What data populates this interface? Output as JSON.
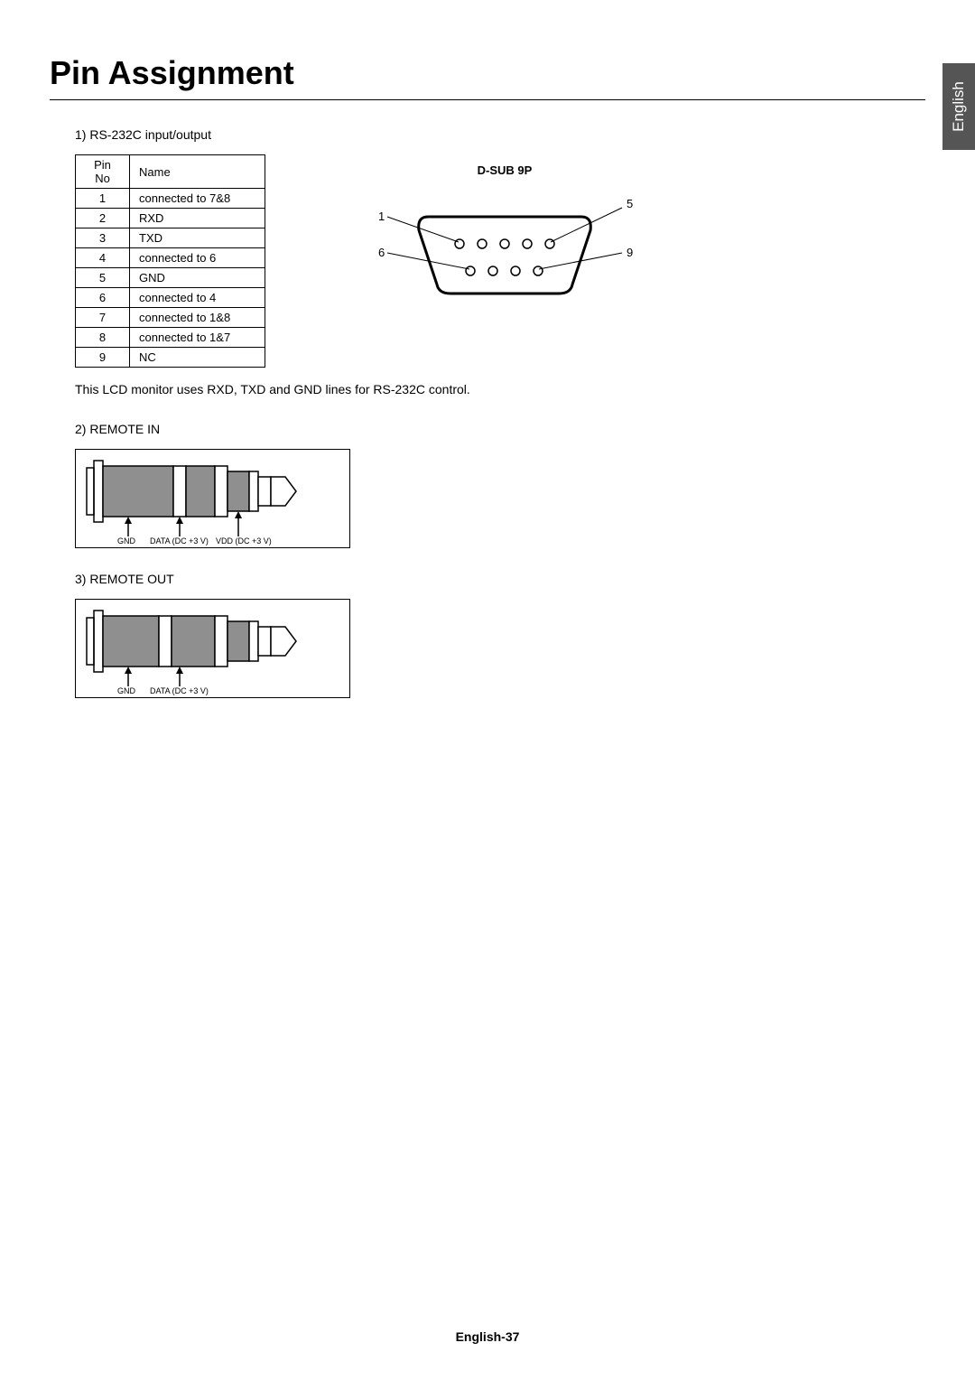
{
  "title": "Pin Assignment",
  "sideTab": "English",
  "section1": {
    "label": "1)  RS-232C input/output",
    "tableHeader": {
      "col1": "Pin No",
      "col2": "Name"
    },
    "rows": [
      {
        "no": "1",
        "name": "connected to 7&8"
      },
      {
        "no": "2",
        "name": "RXD"
      },
      {
        "no": "3",
        "name": "TXD"
      },
      {
        "no": "4",
        "name": "connected to 6"
      },
      {
        "no": "5",
        "name": "GND"
      },
      {
        "no": "6",
        "name": "connected to 4"
      },
      {
        "no": "7",
        "name": "connected to 1&8"
      },
      {
        "no": "8",
        "name": "connected to 1&7"
      },
      {
        "no": "9",
        "name": "NC"
      }
    ],
    "dsubTitle": "D-SUB 9P",
    "dsubNumbers": {
      "tl": "1",
      "tr": "5",
      "bl": "6",
      "br": "9"
    },
    "note": "This LCD monitor uses RXD, TXD and GND lines for RS-232C control."
  },
  "section2": {
    "label": "2)  REMOTE IN",
    "labels": {
      "gnd": "GND",
      "data": "DATA (DC +3 V)",
      "vdd": "VDD (DC +3 V)"
    }
  },
  "section3": {
    "label": "3)  REMOTE OUT",
    "labels": {
      "gnd": "GND",
      "data": "DATA (DC +3 V)"
    }
  },
  "footer": "English-37"
}
